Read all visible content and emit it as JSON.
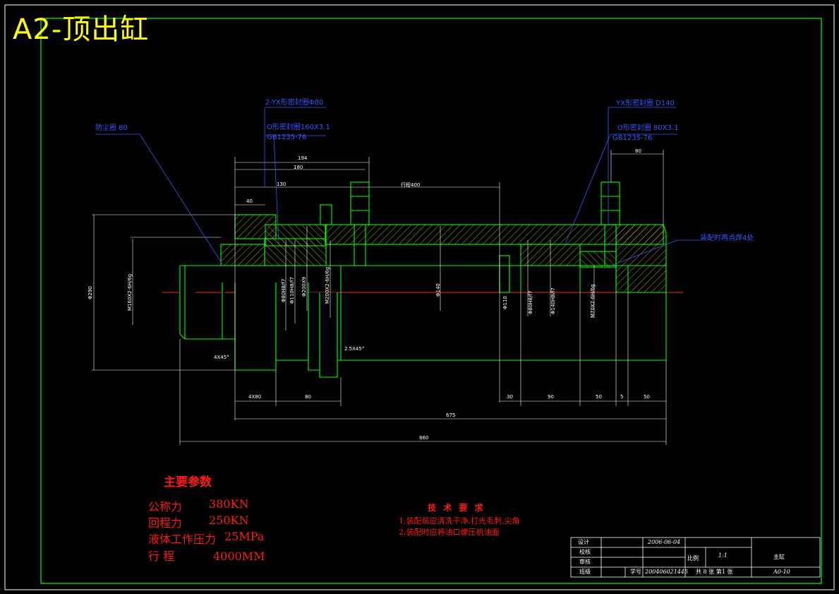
{
  "title": "A2-顶出缸",
  "callouts": {
    "dust_ring": "防尘圈 80",
    "yx_ring_left": "2-YX形密封圈Φ80",
    "o_ring_left": "O形密封圈160X3.1",
    "o_ring_left_std": "GB1235-76",
    "yx_ring_right": "YX形密封圈 D140",
    "o_ring_right": "O形密封圈 80X3.1",
    "o_ring_right_std": "GB1235-76",
    "spot_weld": "装配时再点焊4处"
  },
  "dimensions": {
    "top_194": "194",
    "top_180": "180",
    "top_130": "130",
    "top_40": "40",
    "stroke": "行程400",
    "right_80": "80",
    "dia_140": "Φ140",
    "dia_110": "Φ110",
    "chamfer_left": "4X45°",
    "chamfer_mid": "2.5X45°",
    "bottom_left": "4X80",
    "bottom_80": "80",
    "bottom_r1": "30",
    "bottom_r2": "90",
    "bottom_r3": "50",
    "bottom_r4": "5",
    "bottom_r5": "50",
    "overall_inner": "675",
    "overall": "860",
    "left_height": "Φ290",
    "thread_left": "M160X2-6H/6g",
    "fit_1": "Φ80H8/f7",
    "fit_2": "Φ110H8/f7",
    "fit_3": "Φ200X9",
    "thread_mid": "M200X2-6H/6g",
    "fit_4": "Φ80H8/f7",
    "fit_5": "Φ140H8/f7",
    "thread_right": "M70X2-6H/6g"
  },
  "parameters": {
    "heading": "主要参数",
    "rows": [
      {
        "label": "公称力",
        "value": "380KN"
      },
      {
        "label": "回程力",
        "value": "250KN"
      },
      {
        "label": "液体工作压力",
        "value": "25MPa"
      },
      {
        "label": "行 程",
        "value": "4000MM"
      }
    ]
  },
  "technical_requirements": {
    "heading": "技 术 要 求",
    "lines": [
      "1,装配前应清洗干净,打光毛刺,尖角",
      "2,装配时应将油口螺压机油面"
    ]
  },
  "title_block": {
    "design_label": "设计",
    "design_date": "2006-06-04",
    "check_label": "校核",
    "review_label": "审核",
    "class_label": "班级",
    "student_no_label": "学号",
    "student_no": "200406021445",
    "scale_label": "比例",
    "scale_value": "1:1",
    "part_name": "主缸",
    "sheets": "共 8 张  第1 张",
    "drawing_no": "A0-10"
  },
  "colors": {
    "background": "#000000",
    "outline": "#00ff00",
    "dimension": "#ffffff",
    "annotation": "#3b54ff",
    "centerline": "#ff2020",
    "hatch": "#ffff00",
    "title": "#ffff00",
    "note_text": "#ff1a1a",
    "border": "#ffffff"
  }
}
